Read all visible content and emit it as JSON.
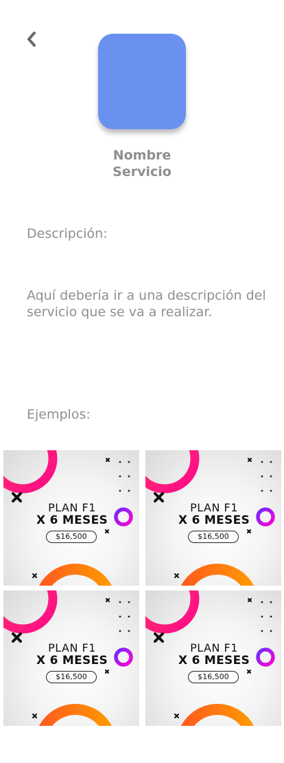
{
  "header": {
    "back_icon": "chevron-left-icon",
    "logo_color": "#6B91F0",
    "service_name_line1": "Nombre",
    "service_name_line2": "Servicio"
  },
  "description": {
    "label": "Descripción:",
    "text": "Aquí debería ir a una descripción del servicio que se va a realizar."
  },
  "examples": {
    "label": "Ejemplos:",
    "items": [
      {
        "title": "PLAN F1",
        "subtitle": "X 6 MESES",
        "price": "$16,500"
      },
      {
        "title": "PLAN F1",
        "subtitle": "X 6 MESES",
        "price": "$16,500"
      },
      {
        "title": "PLAN F1",
        "subtitle": "X 6 MESES",
        "price": "$16,500"
      },
      {
        "title": "PLAN F1",
        "subtitle": "X 6 MESES",
        "price": "$16,500"
      }
    ]
  },
  "colors": {
    "text_gray": "#8F8F8F",
    "ring_pink": "#FF1F6E",
    "ring_orange": "#FF7A00",
    "ring_purple": "#A300FF"
  }
}
